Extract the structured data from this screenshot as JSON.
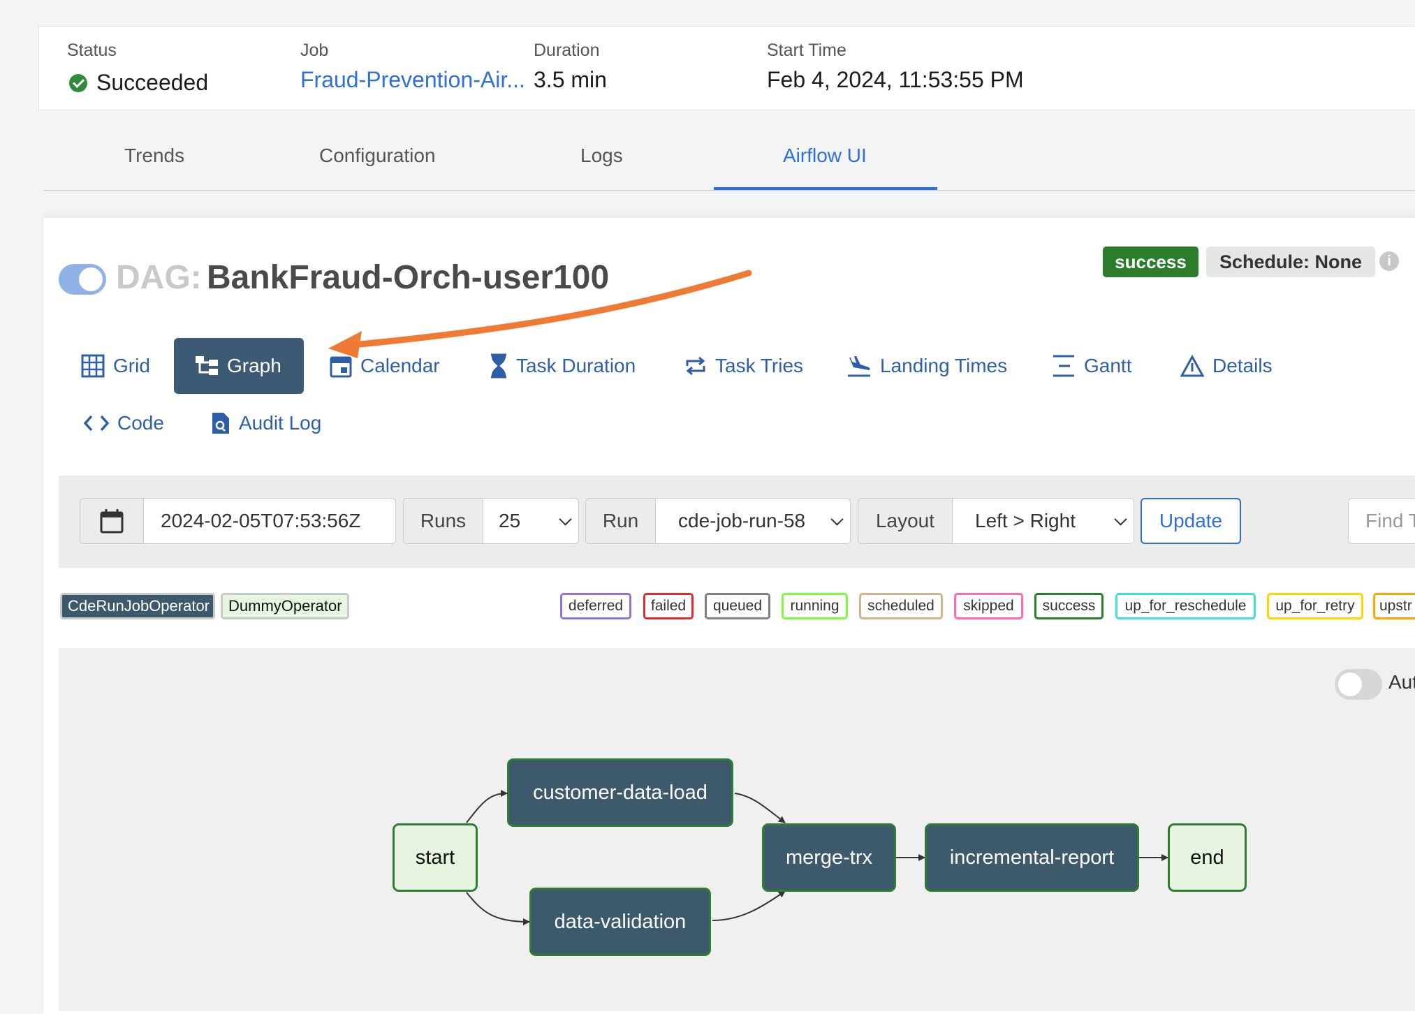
{
  "summary": {
    "status_label": "Status",
    "status_value": "Succeeded",
    "job_label": "Job",
    "job_value": "Fraud-Prevention-Air...",
    "duration_label": "Duration",
    "duration_value": "3.5 min",
    "start_label": "Start Time",
    "start_value": "Feb 4, 2024, 11:53:55 PM"
  },
  "tabs": [
    {
      "label": "Trends"
    },
    {
      "label": "Configuration"
    },
    {
      "label": "Logs"
    },
    {
      "label": "Airflow UI",
      "active": true
    }
  ],
  "dag": {
    "prefix": "DAG:",
    "name": "BankFraud-Orch-user100",
    "state_badge": "success",
    "schedule_badge": "Schedule: None",
    "info_icon": "info-icon"
  },
  "views": [
    {
      "label": "Grid",
      "icon": "grid-icon"
    },
    {
      "label": "Graph",
      "icon": "graph-icon",
      "active": true
    },
    {
      "label": "Calendar",
      "icon": "calendar-icon"
    },
    {
      "label": "Task Duration",
      "icon": "hourglass-icon"
    },
    {
      "label": "Task Tries",
      "icon": "retry-icon"
    },
    {
      "label": "Landing Times",
      "icon": "plane-landing-icon"
    },
    {
      "label": "Gantt",
      "icon": "gantt-icon"
    },
    {
      "label": "Details",
      "icon": "warning-triangle-icon"
    },
    {
      "label": "Code",
      "icon": "code-icon"
    },
    {
      "label": "Audit Log",
      "icon": "audit-file-icon"
    }
  ],
  "controls": {
    "date_value": "2024-02-05T07:53:56Z",
    "runs_label": "Runs",
    "runs_value": "25",
    "run_label": "Run",
    "run_value": "cde-job-run-58",
    "layout_label": "Layout",
    "layout_value": "Left > Right",
    "update_label": "Update",
    "find_placeholder": "Find T"
  },
  "operator_legend": [
    {
      "label": "CdeRunJobOperator",
      "bg": "#3d5a6c",
      "fg": "#ffffff"
    },
    {
      "label": "DummyOperator",
      "bg": "#e8f5e3",
      "fg": "#111111"
    }
  ],
  "state_legend": [
    {
      "label": "deferred",
      "color": "#9370db"
    },
    {
      "label": "failed",
      "color": "#e0292b"
    },
    {
      "label": "queued",
      "color": "#808080"
    },
    {
      "label": "running",
      "color": "#7cfc3a"
    },
    {
      "label": "scheduled",
      "color": "#d2b48c"
    },
    {
      "label": "skipped",
      "color": "#ff69b4"
    },
    {
      "label": "success",
      "color": "#2a7d2e"
    },
    {
      "label": "up_for_reschedule",
      "color": "#40e0d0"
    },
    {
      "label": "up_for_retry",
      "color": "#ffd700"
    },
    {
      "label": "upstr",
      "color": "#ffa500"
    }
  ],
  "graph": {
    "auto_refresh_label": "Aut",
    "nodes": {
      "start": "start",
      "customer_data_load": "customer-data-load",
      "data_validation": "data-validation",
      "merge_trx": "merge-trx",
      "incremental_report": "incremental-report",
      "end": "end"
    }
  },
  "annotation": {
    "arrow_color": "#ee7a33"
  }
}
